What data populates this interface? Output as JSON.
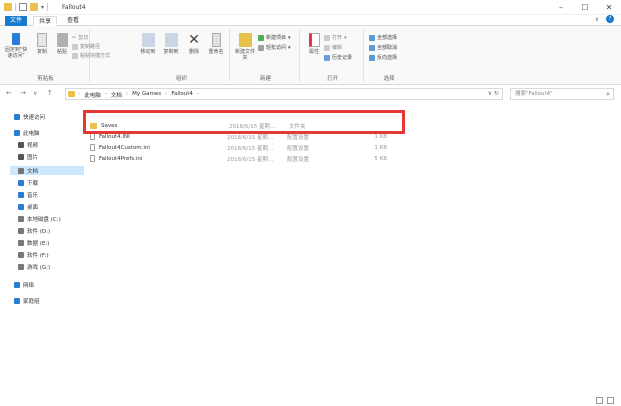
{
  "window": {
    "title": "Fallout4",
    "controls": [
      "–",
      "☐",
      "✕"
    ]
  },
  "tabs": [
    {
      "label": "文件",
      "active": true
    },
    {
      "label": "共享",
      "active": false
    },
    {
      "label": "查看",
      "active": false
    }
  ],
  "ribbon": {
    "clipboard": {
      "label": "剪贴板",
      "pin_label": "固定到\"快速访问\"",
      "copy_label": "复制",
      "paste_label": "粘贴",
      "cut_label": "剪切",
      "copy_path_label": "复制路径",
      "paste_shortcut_label": "粘贴快捷方式"
    },
    "organize": {
      "label": "组织",
      "move_label": "移动到",
      "copy_to_label": "复制到",
      "delete_label": "删除",
      "rename_label": "重命名"
    },
    "new": {
      "label": "新建",
      "new_folder_label": "新建文件夹",
      "new_item_label": "新建项目",
      "easy_access_label": "轻松访问"
    },
    "open": {
      "label": "打开",
      "properties_label": "属性",
      "open_label": "打开",
      "edit_label": "编辑",
      "history_label": "历史记录"
    },
    "select": {
      "label": "选择",
      "select_all_label": "全部选择",
      "select_none_label": "全部取消",
      "invert_label": "反向选择"
    }
  },
  "address": {
    "crumbs": [
      "此电脑",
      "文档",
      "My Games",
      "Fallout4"
    ],
    "search_placeholder": "搜索\"Fallout4\""
  },
  "sidebar": {
    "items": [
      {
        "label": "快速访问",
        "icon": "star-icon",
        "color": "#2b7cd3"
      },
      {
        "label": "此电脑",
        "icon": "computer-icon",
        "color": "#2b7cd3"
      },
      {
        "label": "视频",
        "icon": "video-icon",
        "color": "#555555"
      },
      {
        "label": "图片",
        "icon": "picture-icon",
        "color": "#555555"
      },
      {
        "label": "文档",
        "icon": "document-icon",
        "color": "#777777"
      },
      {
        "label": "下载",
        "icon": "download-icon",
        "color": "#2b7cd3"
      },
      {
        "label": "音乐",
        "icon": "music-icon",
        "color": "#2b7cd3"
      },
      {
        "label": "桌面",
        "icon": "desktop-icon",
        "color": "#2b7cd3"
      },
      {
        "label": "本地磁盘 (C:)",
        "icon": "drive-icon",
        "color": "#777777"
      },
      {
        "label": "软件 (D:)",
        "icon": "drive-icon",
        "color": "#777777"
      },
      {
        "label": "数据 (E:)",
        "icon": "drive-icon",
        "color": "#777777"
      },
      {
        "label": "软件 (F:)",
        "icon": "drive-icon",
        "color": "#777777"
      },
      {
        "label": "游戏 (G:)",
        "icon": "drive-icon",
        "color": "#777777"
      },
      {
        "label": "网络",
        "icon": "network-icon",
        "color": "#2b7cd3"
      },
      {
        "label": "家庭组",
        "icon": "homegroup-icon",
        "color": "#2b7cd3"
      }
    ]
  },
  "files": [
    {
      "name": "Saves",
      "date": "2018/6/15 星期...",
      "type": "文件夹",
      "size": "",
      "icon": "folder-icon",
      "color": "#e8c14a"
    },
    {
      "name": "Fallout4.INI",
      "date": "2018/6/15 星期...",
      "type": "配置设置",
      "size": "1 KB",
      "icon": "ini-file-icon",
      "color": "#9e9e9e"
    },
    {
      "name": "Fallout4Custom.ini",
      "date": "2018/6/15 星期...",
      "type": "配置设置",
      "size": "1 KB",
      "icon": "ini-file-icon",
      "color": "#9e9e9e"
    },
    {
      "name": "Fallout4Prefs.ini",
      "date": "2018/6/15 星期...",
      "type": "配置设置",
      "size": "5 KB",
      "icon": "ini-file-icon",
      "color": "#9e9e9e"
    }
  ]
}
